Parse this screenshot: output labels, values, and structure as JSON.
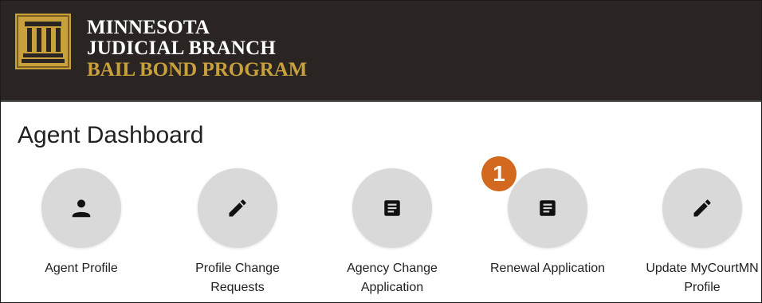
{
  "header": {
    "line1": "MINNESOTA",
    "line2": "JUDICIAL BRANCH",
    "line3": "BAIL BOND PROGRAM",
    "logo_icon": "courthouse-icon",
    "colors": {
      "background": "#2a2522",
      "accent": "#c9a13c"
    }
  },
  "page": {
    "title": "Agent Dashboard"
  },
  "tiles": [
    {
      "icon": "person-icon",
      "line1": "Agent Profile",
      "line2": ""
    },
    {
      "icon": "pencil-icon",
      "line1": "Profile Change",
      "line2": "Requests"
    },
    {
      "icon": "document-icon",
      "line1": "Agency Change",
      "line2": "Application"
    },
    {
      "icon": "document-icon",
      "line1": "Renewal Application",
      "line2": ""
    },
    {
      "icon": "pencil-icon",
      "line1": "Update MyCourtMN",
      "line2": "Profile"
    }
  ],
  "annotation": {
    "badge": "1",
    "color": "#d2691e"
  }
}
